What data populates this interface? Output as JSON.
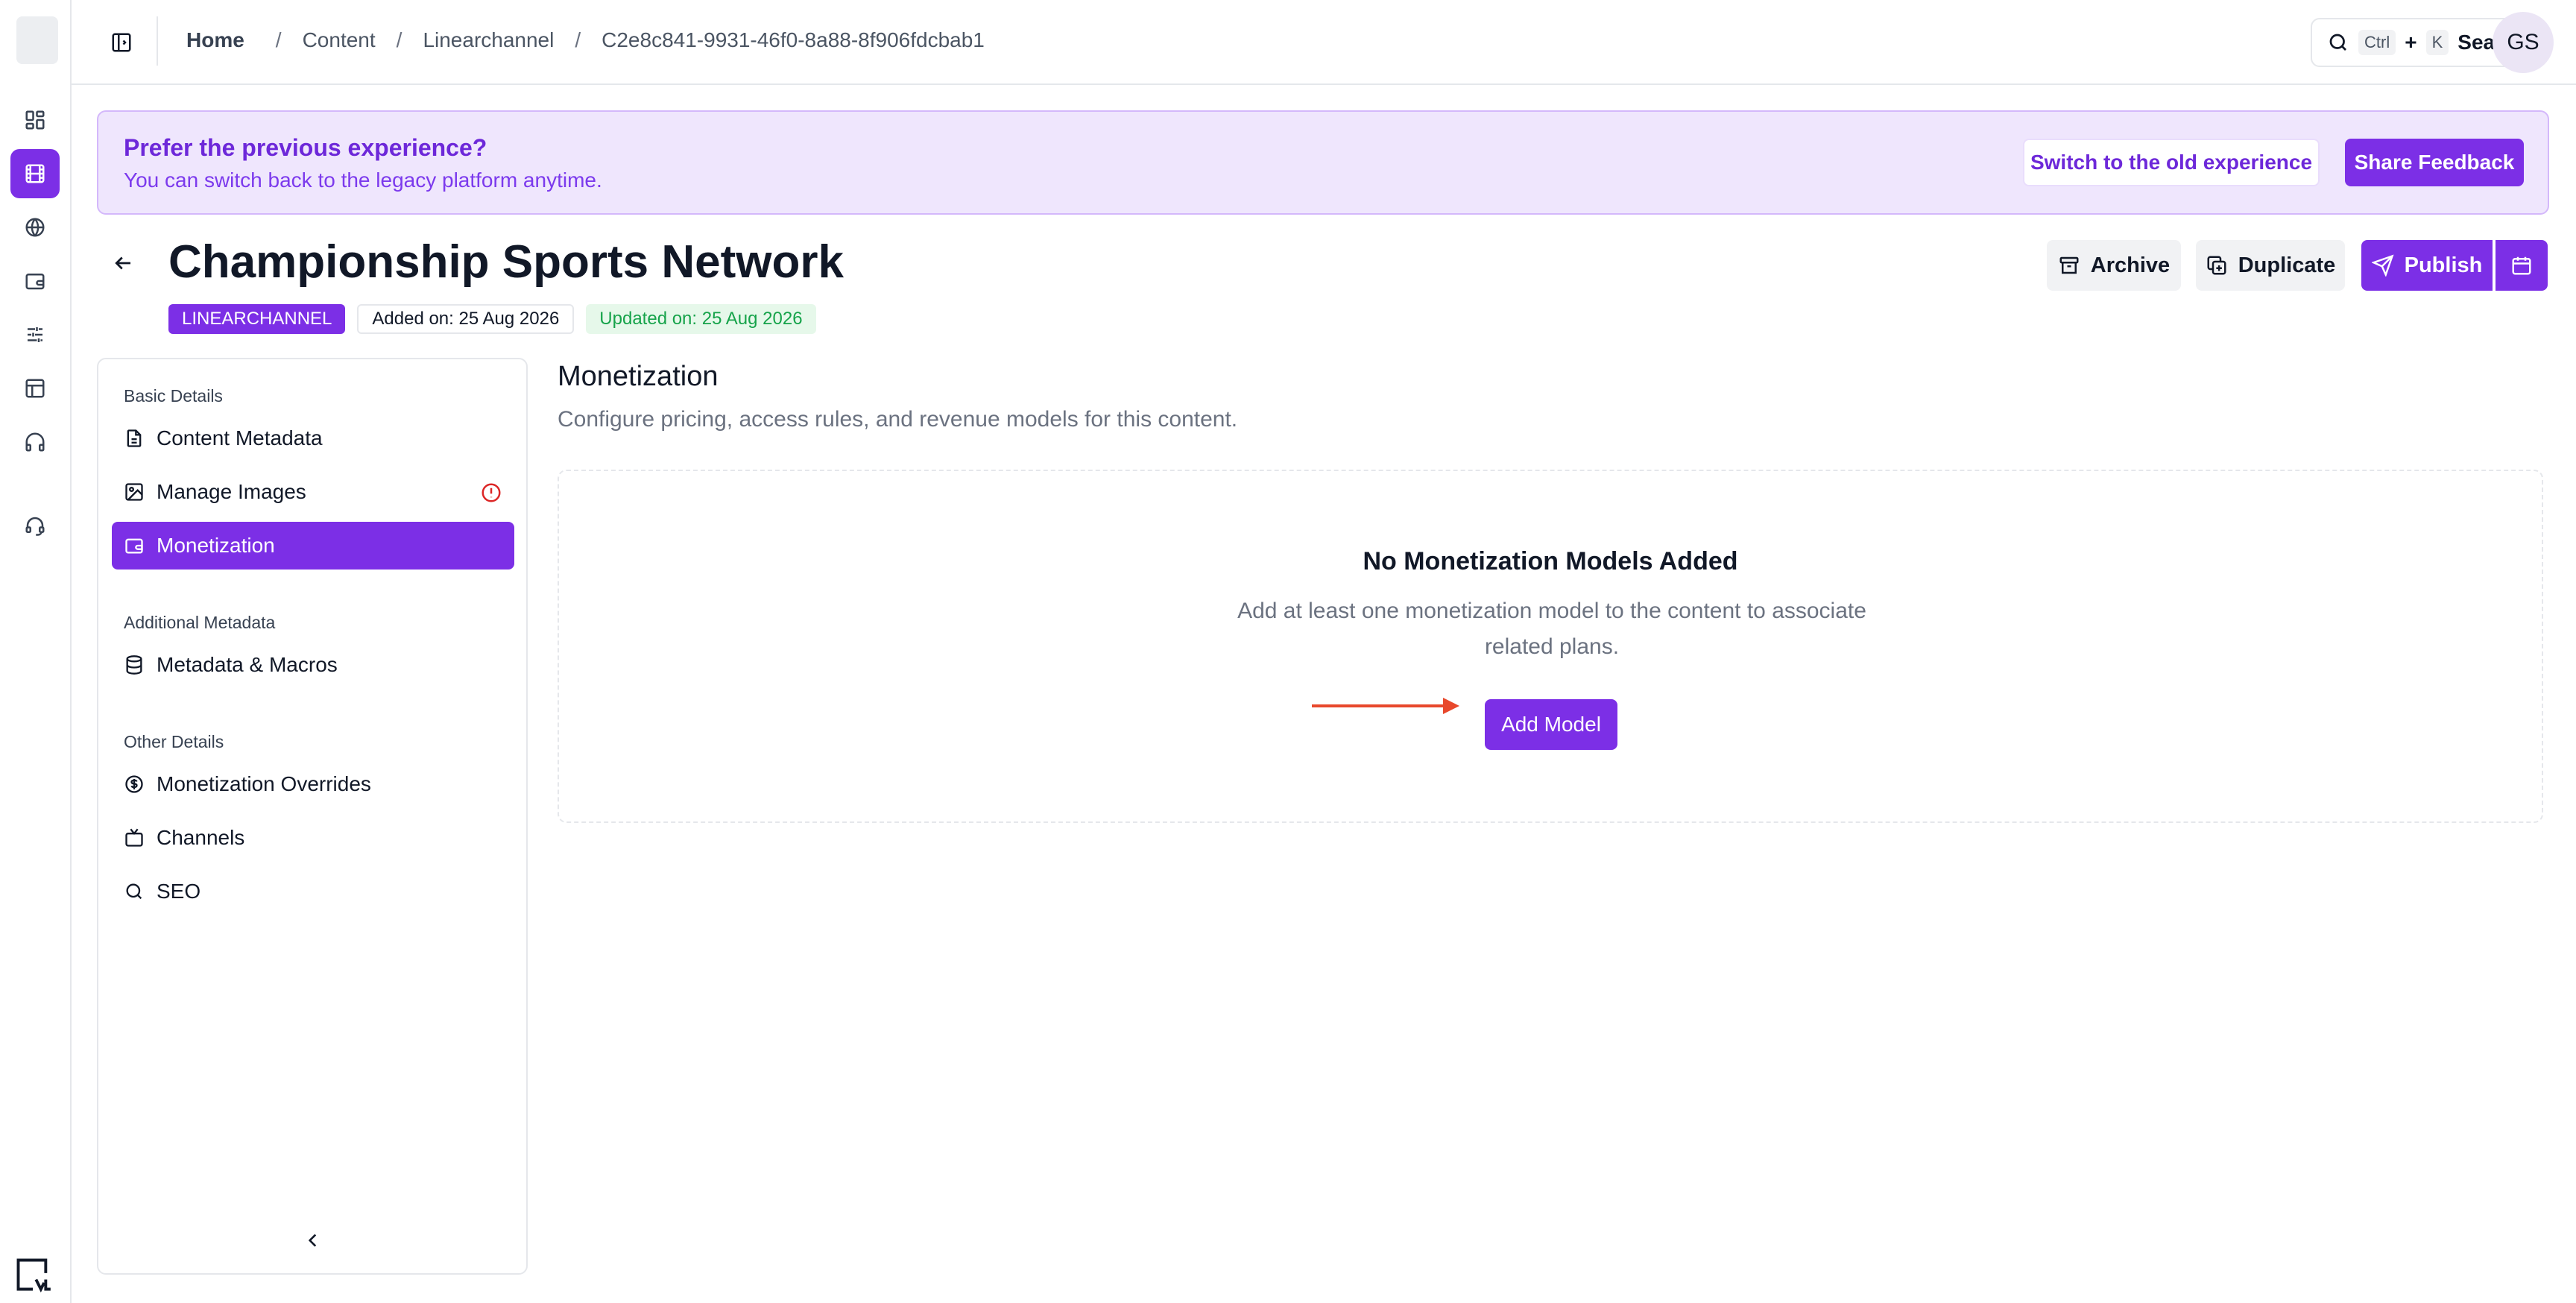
{
  "topbar": {
    "breadcrumb": [
      {
        "label": "Home"
      },
      {
        "label": "Content"
      },
      {
        "label": "Linearchannel"
      },
      {
        "label": "C2e8c841-9931-46f0-8a88-8f906fdcbab1"
      }
    ],
    "search": {
      "kbd_ctrl": "Ctrl",
      "plus": "+",
      "kbd_k": "K",
      "label": "Search"
    },
    "avatar_initials": "GS"
  },
  "banner": {
    "title": "Prefer the previous experience?",
    "subtitle": "You can switch back to the legacy platform anytime.",
    "switch_label": "Switch to the old experience",
    "feedback_label": "Share Feedback"
  },
  "header": {
    "title": "Championship Sports Network",
    "type_badge": "LINEARCHANNEL",
    "added": "Added on: 25 Aug 2026",
    "updated": "Updated on: 25 Aug 2026",
    "archive_label": "Archive",
    "duplicate_label": "Duplicate",
    "publish_label": "Publish"
  },
  "nav": {
    "basic_heading": "Basic Details",
    "content_metadata": "Content Metadata",
    "manage_images": "Manage Images",
    "monetization": "Monetization",
    "additional_heading": "Additional Metadata",
    "metadata_macros": "Metadata & Macros",
    "other_heading": "Other Details",
    "monetization_overrides": "Monetization Overrides",
    "channels": "Channels",
    "seo": "SEO"
  },
  "main": {
    "title": "Monetization",
    "description": "Configure pricing, access rules, and revenue models for this content.",
    "empty_title": "No Monetization Models Added",
    "empty_desc": "Add at least one monetization model to the content to associate related plans.",
    "add_model_label": "Add Model"
  },
  "colors": {
    "accent": "#7c2fe6",
    "banner_bg": "#efe6fd",
    "success": "#16a34a",
    "warning": "#dc2626",
    "annotation_arrow": "#e8482c"
  },
  "icons": {
    "rail": [
      "dashboard-icon",
      "film-icon",
      "globe-icon",
      "wallet-icon",
      "sliders-icon",
      "layout-icon",
      "headphones-icon",
      "support-icon"
    ]
  }
}
